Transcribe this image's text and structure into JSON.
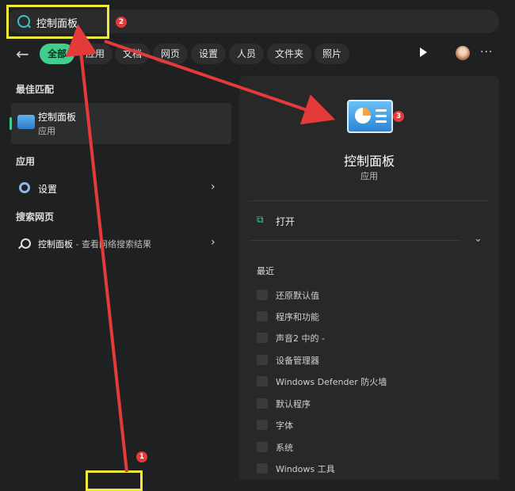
{
  "search": {
    "value": "控制面板"
  },
  "filters": {
    "back_icon": "arrow-left-icon",
    "chips": [
      "全部",
      "应用",
      "文档",
      "网页",
      "设置",
      "人员",
      "文件夹",
      "照片"
    ],
    "more_label": "···"
  },
  "left": {
    "best_match_heading": "最佳匹配",
    "best_match": {
      "title": "控制面板",
      "subtitle": "应用"
    },
    "apps_heading": "应用",
    "settings_item": "设置",
    "web_heading": "搜索网页",
    "web_item_title": "控制面板",
    "web_item_suffix": " - 查看网络搜索结果"
  },
  "right": {
    "app_title": "控制面板",
    "app_subtitle": "应用",
    "open_label": "打开",
    "recent_heading": "最近",
    "recent_items": [
      "还原默认值",
      "程序和功能",
      "声音2 中的 -",
      "设备管理器",
      "Windows Defender 防火墙",
      "默认程序",
      "字体",
      "系统",
      "Windows 工具"
    ]
  },
  "annotations": {
    "badge_1": "1",
    "badge_2": "2",
    "badge_3": "3"
  },
  "colors": {
    "accent": "#3ecf8e",
    "annotation_yellow": "#f2ea3a",
    "annotation_red": "#e43a3a"
  }
}
